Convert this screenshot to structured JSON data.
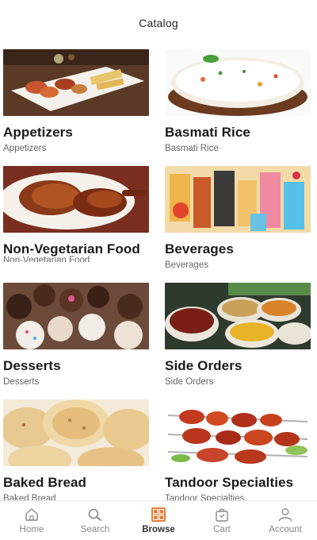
{
  "header": {
    "title": "Catalog"
  },
  "categories": [
    {
      "title": "Appetizers",
      "subtitle": "Appetizers",
      "image": "appetizer-platter-photo"
    },
    {
      "title": "Basmati Rice",
      "subtitle": "Basmati Rice",
      "image": "basmati-rice-bowl-photo"
    },
    {
      "title": "Non-Vegetarian Food",
      "subtitle": "Non-Vegetarian Food",
      "image": "roast-chicken-photo"
    },
    {
      "title": "Beverages",
      "subtitle": "Beverages",
      "image": "drinks-glasses-photo"
    },
    {
      "title": "Desserts",
      "subtitle": "Desserts",
      "image": "chocolate-truffles-photo"
    },
    {
      "title": "Side Orders",
      "subtitle": "Side Orders",
      "image": "side-dish-bowls-photo"
    },
    {
      "title": "Baked Bread",
      "subtitle": "Baked Bread",
      "image": "paratha-bread-photo"
    },
    {
      "title": "Tandoor Specialties",
      "subtitle": "Tandoor Specialties",
      "image": "tandoori-skewers-photo"
    }
  ],
  "tabbar": {
    "active": "Browse",
    "accent": "#e8772e",
    "items": [
      {
        "label": "Home",
        "icon": "home-icon"
      },
      {
        "label": "Search",
        "icon": "search-icon"
      },
      {
        "label": "Browse",
        "icon": "grid-icon"
      },
      {
        "label": "Cart",
        "icon": "bag-icon"
      },
      {
        "label": "Account",
        "icon": "user-icon"
      }
    ]
  }
}
